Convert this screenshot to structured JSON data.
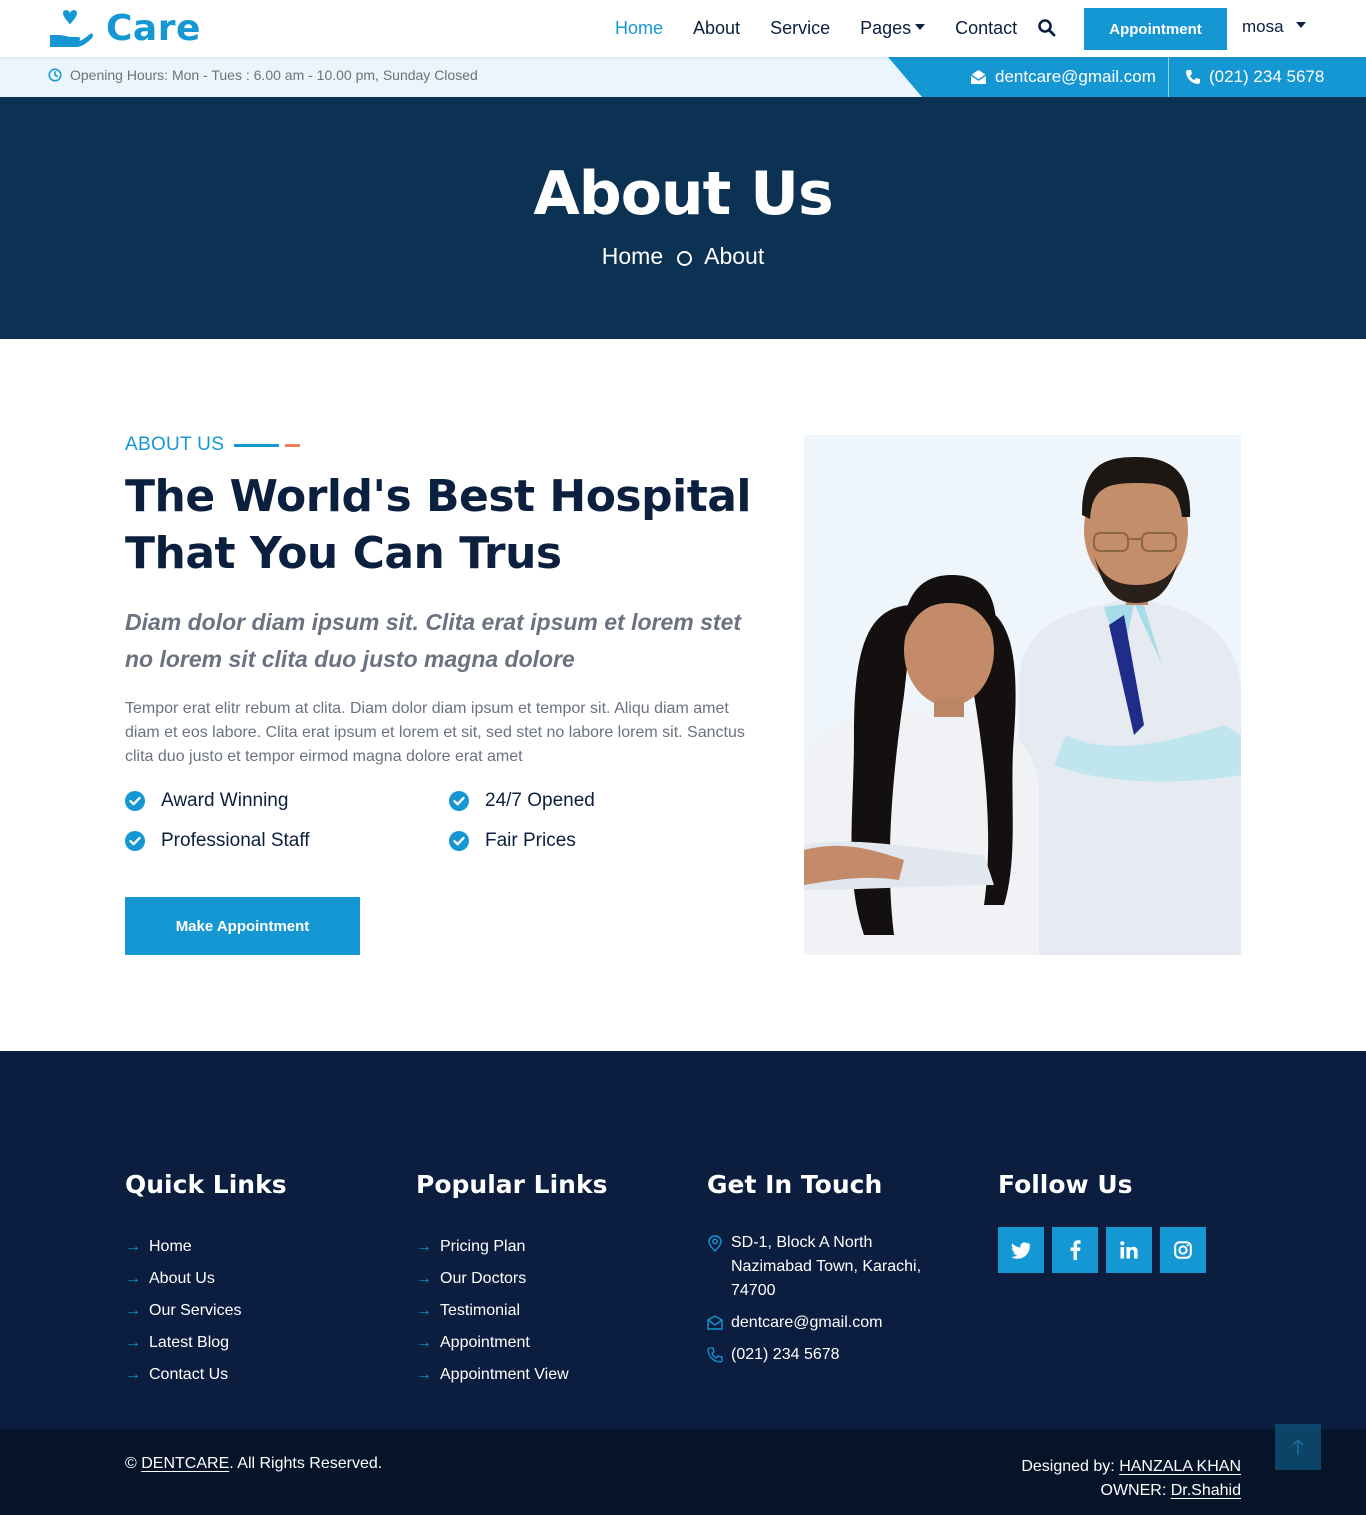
{
  "brand": {
    "name": "Care"
  },
  "nav": {
    "items": [
      {
        "label": "Home",
        "active": true
      },
      {
        "label": "About"
      },
      {
        "label": "Service"
      },
      {
        "label": "Pages",
        "dropdown": true
      },
      {
        "label": "Contact"
      }
    ],
    "appointment_label": "Appointment",
    "user_label": "mosa"
  },
  "topbar": {
    "hours": "Opening Hours: Mon - Tues : 6.00 am - 10.00 pm, Sunday Closed",
    "email": "dentcare@gmail.com",
    "phone": "(021) 234 5678"
  },
  "hero": {
    "title": "About Us",
    "breadcrumb": [
      "Home",
      "About"
    ]
  },
  "about": {
    "eyebrow": "ABOUT US",
    "heading": "The World's Best Hospital That You Can Trus",
    "lead": "Diam dolor diam ipsum sit. Clita erat ipsum et lorem stet no lorem sit clita duo justo magna dolore",
    "body": "Tempor erat elitr rebum at clita. Diam dolor diam ipsum et tempor sit. Aliqu diam amet diam et eos labore. Clita erat ipsum et lorem et sit, sed stet no labore lorem sit. Sanctus clita duo justo et tempor eirmod magna dolore erat amet",
    "features": [
      "Award Winning",
      "24/7 Opened",
      "Professional Staff",
      "Fair Prices"
    ],
    "button": "Make Appointment"
  },
  "footer": {
    "quick_links": {
      "heading": "Quick Links",
      "items": [
        "Home",
        "About Us",
        "Our Services",
        "Latest Blog",
        "Contact Us"
      ]
    },
    "popular_links": {
      "heading": "Popular Links",
      "items": [
        "Pricing Plan",
        "Our Doctors",
        "Testimonial",
        "Appointment",
        "Appointment View"
      ]
    },
    "contact": {
      "heading": "Get In Touch",
      "address": "SD-1, Block A North Nazimabad Town, Karachi, 74700",
      "email": "dentcare@gmail.com",
      "phone": "(021) 234 5678"
    },
    "follow": {
      "heading": "Follow Us",
      "icons": [
        "twitter-icon",
        "facebook-icon",
        "linkedin-icon",
        "instagram-icon"
      ]
    },
    "copyright_prefix": "©",
    "copyright_brand": "DENTCARE",
    "copyright_suffix": ". All Rights Reserved.",
    "designed_by_label": "Designed by:",
    "designer": "HANZALA KHAN",
    "owner_label": "OWNER:",
    "owner": "Dr.Shahid"
  },
  "colors": {
    "accent": "#1597d4",
    "hero_bg": "#0b3153",
    "footer_bg": "#0b1e3f",
    "highlight": "#ef7e5a"
  }
}
